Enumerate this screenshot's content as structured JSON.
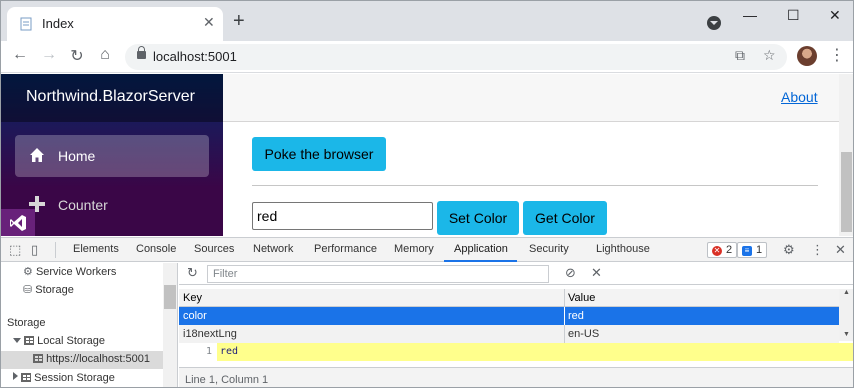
{
  "browser": {
    "tab_title": "Index",
    "url": "localhost:5001"
  },
  "app": {
    "brand": "Northwind.BlazorServer",
    "nav": [
      {
        "label": "Home",
        "icon": "home-icon"
      },
      {
        "label": "Counter",
        "icon": "plus-icon"
      }
    ],
    "about_link": "About",
    "poke_button": "Poke the browser",
    "color_input_value": "red",
    "set_color_button": "Set Color",
    "get_color_button": "Get Color"
  },
  "devtools": {
    "tabs": [
      "Elements",
      "Console",
      "Sources",
      "Network",
      "Performance",
      "Memory",
      "Application",
      "Security",
      "Lighthouse"
    ],
    "active_tab": "Application",
    "error_count": "2",
    "message_count": "1",
    "sidebar": {
      "service_workers": "Service Workers",
      "storage_top": "Storage",
      "storage_section": "Storage",
      "local_storage": "Local Storage",
      "local_storage_origin": "https://localhost:5001",
      "session_storage": "Session Storage"
    },
    "filter_placeholder": "Filter",
    "table": {
      "headers": [
        "Key",
        "Value"
      ],
      "rows": [
        {
          "key": "color",
          "value": "red"
        },
        {
          "key": "i18nextLng",
          "value": "en-US"
        }
      ]
    },
    "preview_line_number": "1",
    "preview_code": "red",
    "status": "Line 1, Column 1"
  },
  "colors": {
    "accent_blue": "#1a73e8",
    "selected_row": "#1a73e8",
    "button_cyan": "#1bb7e8",
    "sidebar_top": "#052767",
    "sidebar_bottom": "#3a0647"
  }
}
